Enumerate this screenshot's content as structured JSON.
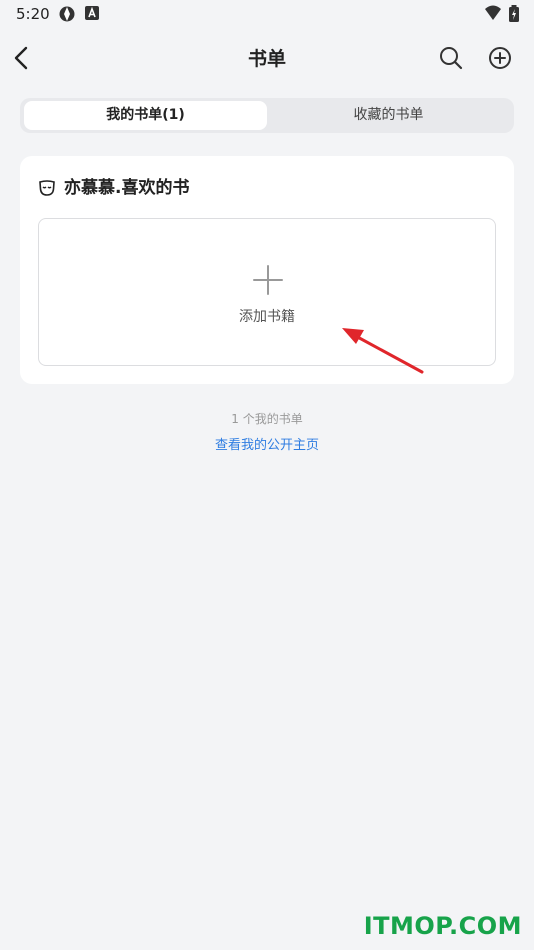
{
  "status_bar": {
    "time": "5:20"
  },
  "header": {
    "title": "书单"
  },
  "tabs": [
    {
      "label": "我的书单(1)",
      "active": true
    },
    {
      "label": "收藏的书单",
      "active": false
    }
  ],
  "card": {
    "title": "亦慕慕.喜欢的书",
    "add_book_label": "添加书籍"
  },
  "footer": {
    "count_text": "1 个我的书单",
    "public_link": "查看我的公开主页"
  },
  "watermark": "ITMOP.COM",
  "colors": {
    "background": "#f3f4f6",
    "link": "#2f7de1",
    "arrow": "#e0262b",
    "watermark": "#17a34a"
  }
}
